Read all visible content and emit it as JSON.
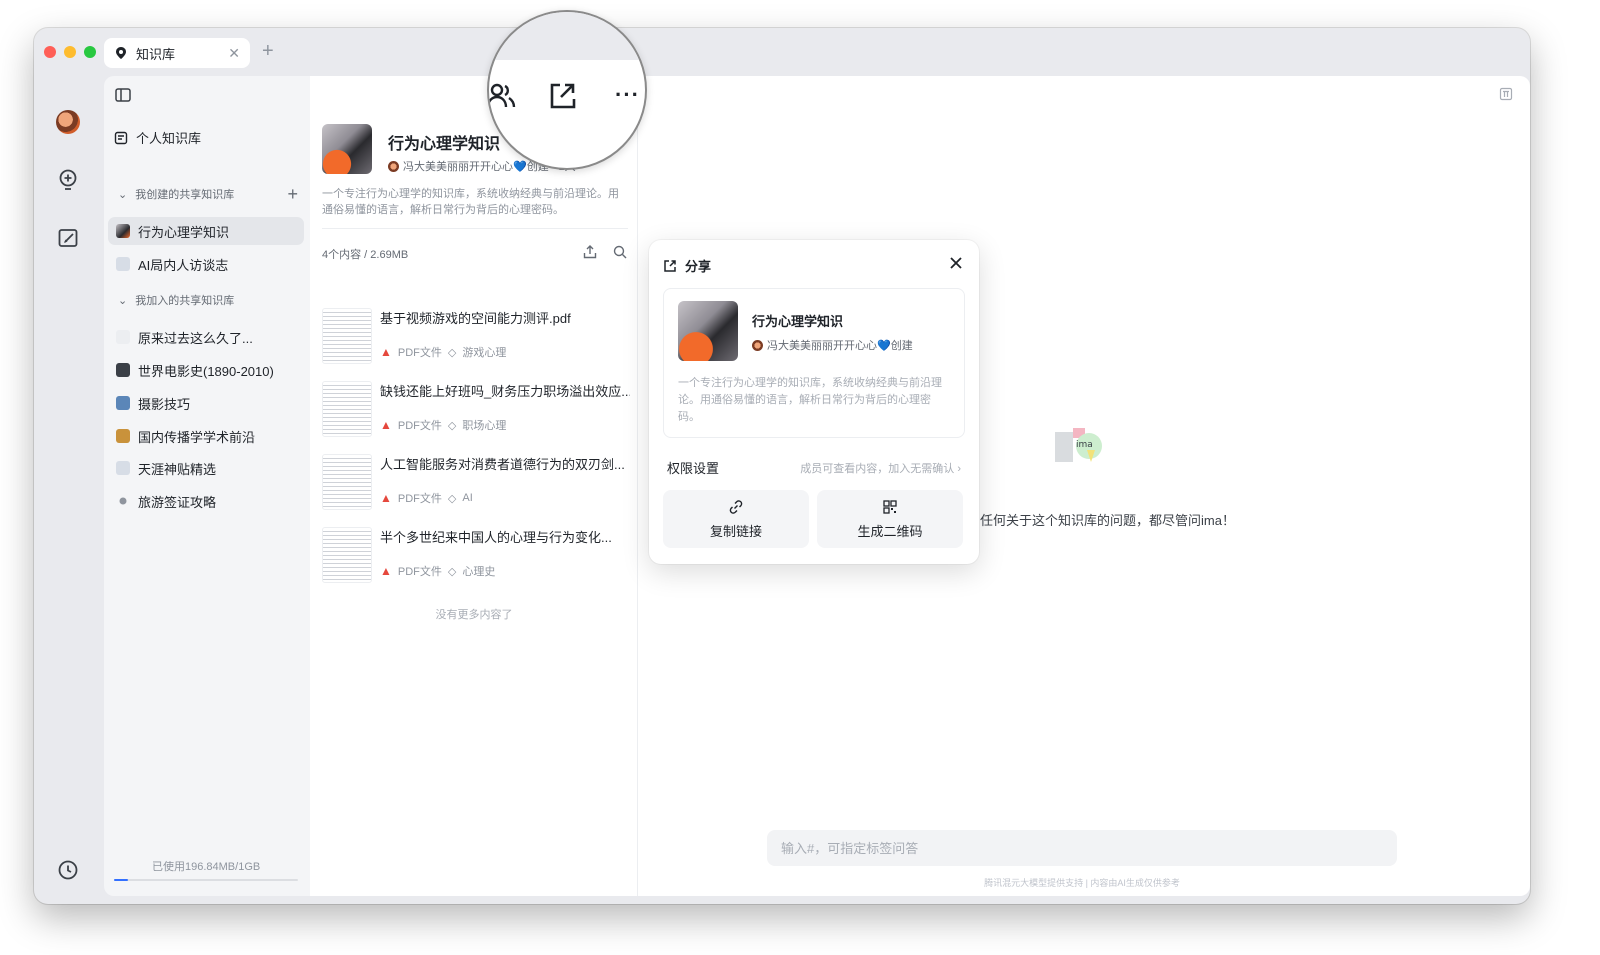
{
  "window": {
    "tab_title": "知识库"
  },
  "sidebar": {
    "personal_label": "个人知识库",
    "created_section": "我创建的共享知识库",
    "created_items": [
      {
        "label": "行为心理学知识",
        "color": "#6b5b5e"
      },
      {
        "label": "AI局内人访谈志",
        "color": "#d7dde6"
      }
    ],
    "joined_section": "我加入的共享知识库",
    "joined_items": [
      {
        "label": "原来过去这么久了...",
        "color": "#eceef1"
      },
      {
        "label": "世界电影史(1890-2010)",
        "color": "#3b4047"
      },
      {
        "label": "摄影技巧",
        "color": "#5b86b8"
      },
      {
        "label": "国内传播学学术前沿",
        "color": "#c9923b"
      },
      {
        "label": "天涯神贴精选",
        "color": "#d7dde6"
      },
      {
        "label": "旅游签证攻略",
        "color": "#8f959e"
      }
    ],
    "storage": "已使用196.84MB/1GB",
    "storage_used_fraction": 0.19
  },
  "kb": {
    "title": "行为心理学知识",
    "creator": "冯大美美丽丽开开心心💙创建 · 1人",
    "description": "一个专注行为心理学的知识库，系统收纳经典与前沿理论。用通俗易懂的语言，解析日常行为背后的心理密码。",
    "stats": "4个内容 / 2.69MB",
    "docs": [
      {
        "title": "基于视频游戏的空间能力测评.pdf",
        "type": "PDF文件",
        "tag": "游戏心理"
      },
      {
        "title": "缺钱还能上好班吗_财务压力职场溢出效应...",
        "type": "PDF文件",
        "tag": "职场心理"
      },
      {
        "title": "人工智能服务对消费者道德行为的双刃剑...",
        "type": "PDF文件",
        "tag": "AI"
      },
      {
        "title": "半个多世纪来中国人的心理与行为变化...",
        "type": "PDF文件",
        "tag": "心理史"
      }
    ],
    "no_more": "没有更多内容了"
  },
  "chat": {
    "logo_text": "ima",
    "hint": "任何关于这个知识库的问题，都尽管问ima！",
    "input_placeholder": "输入#，可指定标签问答",
    "footer": "腾讯混元大模型提供支持 | 内容由AI生成仅供参考"
  },
  "share": {
    "title": "分享",
    "kb_title": "行为心理学知识",
    "creator": "冯大美美丽丽开开心心💙创建",
    "description": "一个专注行为心理学的知识库，系统收纳经典与前沿理论。用通俗易懂的语言，解析日常行为背后的心理密码。",
    "perm_label": "权限设置",
    "perm_value": "成员可查看内容，加入无需确认 ›",
    "copy_link": "复制链接",
    "qr_code": "生成二维码"
  },
  "colors": {
    "accent": "#3370ff",
    "pdf": "#e5483d"
  }
}
